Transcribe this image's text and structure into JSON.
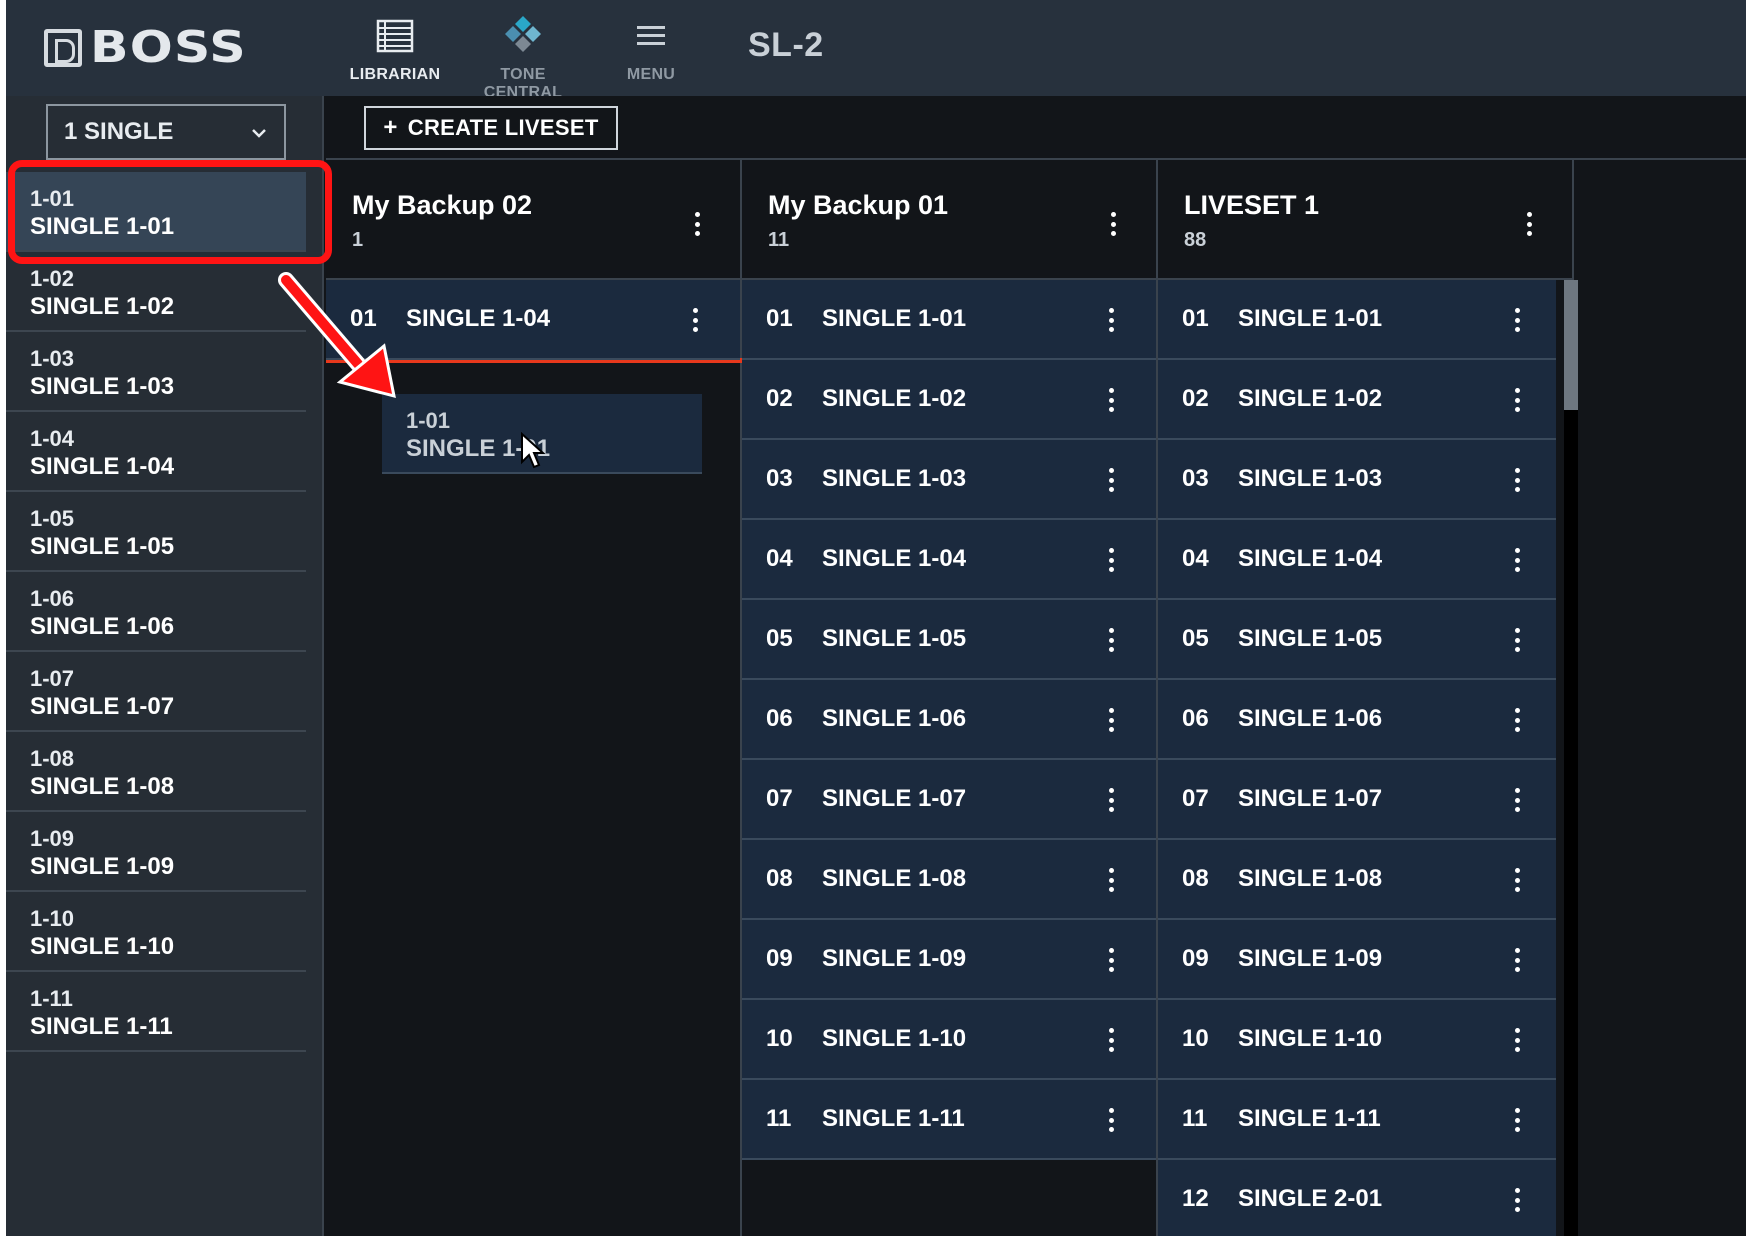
{
  "header": {
    "logo_text": "BOSS",
    "nav": [
      {
        "label": "LIBRARIAN",
        "icon": "librarian-icon",
        "active": true
      },
      {
        "label": "TONE CENTRAL",
        "icon": "tone-central-icon",
        "active": false
      },
      {
        "label": "MENU",
        "icon": "menu-icon",
        "active": false
      }
    ],
    "device": "SL-2"
  },
  "sidebar": {
    "bank_select": "1 SINGLE",
    "items": [
      {
        "num": "1-01",
        "name": "SINGLE 1-01"
      },
      {
        "num": "1-02",
        "name": "SINGLE 1-02"
      },
      {
        "num": "1-03",
        "name": "SINGLE 1-03"
      },
      {
        "num": "1-04",
        "name": "SINGLE 1-04"
      },
      {
        "num": "1-05",
        "name": "SINGLE 1-05"
      },
      {
        "num": "1-06",
        "name": "SINGLE 1-06"
      },
      {
        "num": "1-07",
        "name": "SINGLE 1-07"
      },
      {
        "num": "1-08",
        "name": "SINGLE 1-08"
      },
      {
        "num": "1-09",
        "name": "SINGLE 1-09"
      },
      {
        "num": "1-10",
        "name": "SINGLE 1-10"
      },
      {
        "num": "1-11",
        "name": "SINGLE 1-11"
      }
    ]
  },
  "toolbar": {
    "create_label": "CREATE LIVESET",
    "create_icon": "+"
  },
  "livesets": [
    {
      "title": "My Backup 02",
      "count": "1",
      "rows": [
        {
          "num": "01",
          "name": "SINGLE 1-04"
        }
      ]
    },
    {
      "title": "My Backup 01",
      "count": "11",
      "rows": [
        {
          "num": "01",
          "name": "SINGLE 1-01"
        },
        {
          "num": "02",
          "name": "SINGLE 1-02"
        },
        {
          "num": "03",
          "name": "SINGLE 1-03"
        },
        {
          "num": "04",
          "name": "SINGLE 1-04"
        },
        {
          "num": "05",
          "name": "SINGLE 1-05"
        },
        {
          "num": "06",
          "name": "SINGLE 1-06"
        },
        {
          "num": "07",
          "name": "SINGLE 1-07"
        },
        {
          "num": "08",
          "name": "SINGLE 1-08"
        },
        {
          "num": "09",
          "name": "SINGLE 1-09"
        },
        {
          "num": "10",
          "name": "SINGLE 1-10"
        },
        {
          "num": "11",
          "name": "SINGLE 1-11"
        }
      ]
    },
    {
      "title": "LIVESET 1",
      "count": "88",
      "rows": [
        {
          "num": "01",
          "name": "SINGLE 1-01"
        },
        {
          "num": "02",
          "name": "SINGLE 1-02"
        },
        {
          "num": "03",
          "name": "SINGLE 1-03"
        },
        {
          "num": "04",
          "name": "SINGLE 1-04"
        },
        {
          "num": "05",
          "name": "SINGLE 1-05"
        },
        {
          "num": "06",
          "name": "SINGLE 1-06"
        },
        {
          "num": "07",
          "name": "SINGLE 1-07"
        },
        {
          "num": "08",
          "name": "SINGLE 1-08"
        },
        {
          "num": "09",
          "name": "SINGLE 1-09"
        },
        {
          "num": "10",
          "name": "SINGLE 1-10"
        },
        {
          "num": "11",
          "name": "SINGLE 1-11"
        },
        {
          "num": "12",
          "name": "SINGLE 2-01"
        }
      ]
    }
  ],
  "drag_ghost": {
    "num": "1-01",
    "name": "SINGLE 1-01"
  },
  "colors": {
    "highlight": "#ff1414",
    "drop_indicator": "#e8381c",
    "row_bg": "#1b2a3e",
    "accent_tone_central": "#2aa7c8"
  }
}
